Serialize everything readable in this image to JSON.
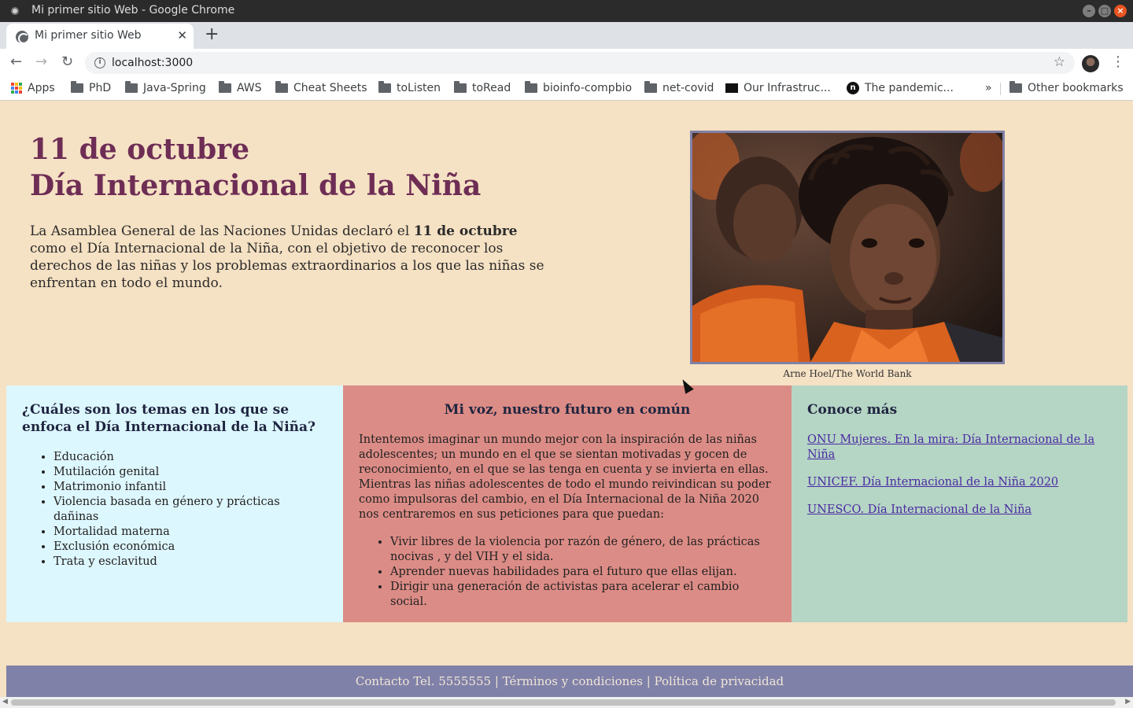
{
  "window": {
    "title": "Mi primer sitio Web - Google Chrome"
  },
  "tab": {
    "title": "Mi primer sitio Web"
  },
  "address_bar": {
    "url": "localhost:3000"
  },
  "bookmarks": [
    {
      "label": "Apps",
      "icon": "apps-grid-icon"
    },
    {
      "label": "PhD",
      "icon": "folder-icon"
    },
    {
      "label": "Java-Spring",
      "icon": "folder-icon"
    },
    {
      "label": "AWS",
      "icon": "folder-icon"
    },
    {
      "label": "Cheat Sheets",
      "icon": "folder-icon"
    },
    {
      "label": "toListen",
      "icon": "folder-icon"
    },
    {
      "label": "toRead",
      "icon": "folder-icon"
    },
    {
      "label": "bioinfo-compbio",
      "icon": "folder-icon"
    },
    {
      "label": "net-covid",
      "icon": "folder-icon"
    },
    {
      "label": "Our Infrastruc...",
      "icon": "site-favicon"
    },
    {
      "label": "The pandemic...",
      "icon": "site-favicon"
    }
  ],
  "bookmarks_overflow": "»",
  "other_bookmarks": "Other bookmarks",
  "hero": {
    "title_line1": "11 de octubre",
    "title_line2": "Día Internacional de la Niña",
    "text_before": "La Asamblea General de las Naciones Unidas declaró el ",
    "text_bold": "11 de octubre",
    "text_after": " como el Día Internacional de la Niña, con el objetivo de reconocer los derechos de las niñas y los problemas extraordinarios a los que las niñas se enfrentan en todo el mundo."
  },
  "photo": {
    "caption": "Arne Hoel/The World Bank"
  },
  "column1": {
    "heading": "¿Cuáles son los temas en los que se enfoca el Día Internacional de la Niña?",
    "items": [
      "Educación",
      "Mutilación genital",
      "Matrimonio infantil",
      "Violencia basada en género y prácticas dañinas",
      "Mortalidad materna",
      "Exclusión económica",
      "Trata y esclavitud"
    ]
  },
  "column2": {
    "heading": "Mi voz, nuestro futuro en común",
    "paragraph": "Intentemos imaginar un mundo mejor con la inspiración de las niñas adolescentes; un mundo en el que se sientan motivadas y gocen de reconocimiento, en el que se las tenga en cuenta y se invierta en ellas. Mientras las niñas adolescentes de todo el mundo reivindican su poder como impulsoras del cambio, en el Día Internacional de la Niña 2020 nos centraremos en sus peticiones para que puedan:",
    "items": [
      "Vivir libres de la violencia por razón de género, de las prácticas nocivas , y del VIH y el sida.",
      "Aprender nuevas habilidades para el futuro que ellas elijan.",
      "Dirigir una generación de activistas para acelerar el cambio social."
    ]
  },
  "column3": {
    "heading": "Conoce más",
    "links": [
      "ONU Mujeres. En la mira: Día Internacional de la Niña",
      "UNICEF. Día Internacional de la Niña 2020",
      "UNESCO. Día Internacional de la Niña"
    ]
  },
  "footer": {
    "text": "Contacto Tel. 5555555 | Términos y condiciones | Política de privacidad"
  },
  "colors": {
    "background": "#f5e1c3",
    "title": "#6e2d55",
    "col1": "#ddf7fe",
    "col2": "#dc8c86",
    "col3": "#b5d5c5",
    "footer": "#8081a8"
  }
}
